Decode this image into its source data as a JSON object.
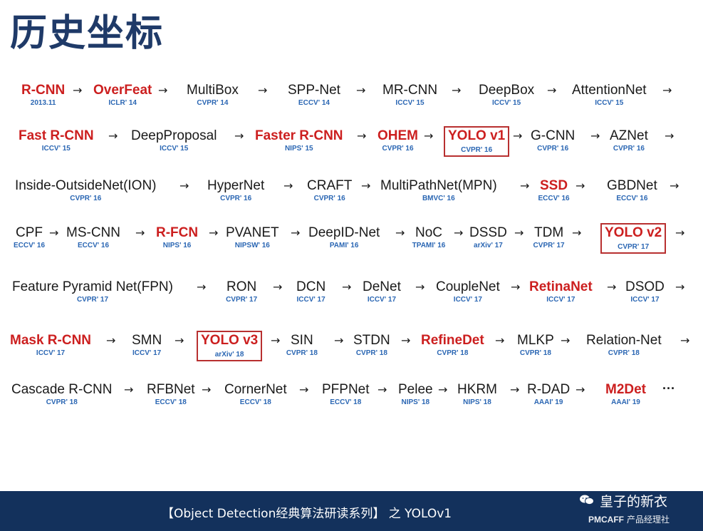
{
  "title": "历史坐标",
  "rows": [
    {
      "items": [
        {
          "name": "R-CNN",
          "venue": "2013.11",
          "highlight": true
        },
        {
          "name": "OverFeat",
          "venue": "ICLR' 14",
          "highlight": true
        },
        {
          "name": "MultiBox",
          "venue": "CVPR' 14"
        },
        {
          "name": "SPP-Net",
          "venue": "ECCV' 14"
        },
        {
          "name": "MR-CNN",
          "venue": "ICCV' 15"
        },
        {
          "name": "DeepBox",
          "venue": "ICCV' 15"
        },
        {
          "name": "AttentionNet",
          "venue": "ICCV' 15"
        }
      ]
    },
    {
      "items": [
        {
          "name": "Fast R-CNN",
          "venue": "ICCV' 15",
          "highlight": true
        },
        {
          "name": "DeepProposal",
          "venue": "ICCV' 15"
        },
        {
          "name": "Faster R-CNN",
          "venue": "NIPS' 15",
          "highlight": true
        },
        {
          "name": "OHEM",
          "venue": "CVPR' 16",
          "highlight": true
        },
        {
          "name": "YOLO v1",
          "venue": "CVPR' 16",
          "highlight": true,
          "boxed": true
        },
        {
          "name": "G-CNN",
          "venue": "CVPR' 16"
        },
        {
          "name": "AZNet",
          "venue": "CVPR' 16"
        }
      ]
    },
    {
      "items": [
        {
          "name": "Inside-OutsideNet(ION)",
          "venue": "CVPR' 16"
        },
        {
          "name": "HyperNet",
          "venue": "CVPR' 16"
        },
        {
          "name": "CRAFT",
          "venue": "CVPR' 16"
        },
        {
          "name": "MultiPathNet(MPN)",
          "venue": "BMVC' 16"
        },
        {
          "name": "SSD",
          "venue": "ECCV' 16",
          "highlight": true
        },
        {
          "name": "GBDNet",
          "venue": "ECCV' 16"
        }
      ]
    },
    {
      "items": [
        {
          "name": "CPF",
          "venue": "ECCV' 16"
        },
        {
          "name": "MS-CNN",
          "venue": "ECCV' 16"
        },
        {
          "name": "R-FCN",
          "venue": "NIPS' 16",
          "highlight": true
        },
        {
          "name": "PVANET",
          "venue": "NIPSW' 16"
        },
        {
          "name": "DeepID-Net",
          "venue": "PAMI' 16"
        },
        {
          "name": "NoC",
          "venue": "TPAMI' 16"
        },
        {
          "name": "DSSD",
          "venue": "arXiv' 17"
        },
        {
          "name": "TDM",
          "venue": "CVPR' 17"
        },
        {
          "name": "YOLO v2",
          "venue": "CVPR' 17",
          "highlight": true,
          "boxed": true
        }
      ]
    },
    {
      "items": [
        {
          "name": "Feature Pyramid Net(FPN)",
          "venue": "CVPR' 17"
        },
        {
          "name": "RON",
          "venue": "CVPR' 17"
        },
        {
          "name": "DCN",
          "venue": "ICCV' 17"
        },
        {
          "name": "DeNet",
          "venue": "ICCV' 17"
        },
        {
          "name": "CoupleNet",
          "venue": "ICCV' 17"
        },
        {
          "name": "RetinaNet",
          "venue": "ICCV' 17",
          "highlight": true
        },
        {
          "name": "DSOD",
          "venue": "ICCV' 17"
        }
      ]
    },
    {
      "items": [
        {
          "name": "Mask R-CNN",
          "venue": "ICCV' 17",
          "highlight": true
        },
        {
          "name": "SMN",
          "venue": "ICCV' 17"
        },
        {
          "name": "YOLO v3",
          "venue": "arXiv' 18",
          "highlight": true,
          "boxed": true
        },
        {
          "name": "SIN",
          "venue": "CVPR' 18"
        },
        {
          "name": "STDN",
          "venue": "CVPR' 18"
        },
        {
          "name": "RefineDet",
          "venue": "CVPR' 18",
          "highlight": true
        },
        {
          "name": "MLKP",
          "venue": "CVPR' 18"
        },
        {
          "name": "Relation-Net",
          "venue": "CVPR' 18"
        }
      ]
    },
    {
      "items": [
        {
          "name": "Cascade R-CNN",
          "venue": "CVPR' 18"
        },
        {
          "name": "RFBNet",
          "venue": "ECCV' 18"
        },
        {
          "name": "CornerNet",
          "venue": "ECCV' 18"
        },
        {
          "name": "PFPNet",
          "venue": "ECCV' 18"
        },
        {
          "name": "Pelee",
          "venue": "NIPS' 18"
        },
        {
          "name": "HKRM",
          "venue": "NIPS' 18"
        },
        {
          "name": "R-DAD",
          "venue": "AAAI' 19"
        },
        {
          "name": "M2Det",
          "venue": "AAAI' 19",
          "highlight": true
        }
      ]
    }
  ],
  "arrow_glyph": "→",
  "ellipsis": "···",
  "footer": {
    "text": "【Object Detection经典算法研读系列】  之  YOLOv1"
  },
  "watermark": {
    "name": "皇子的新衣",
    "brand": "PMCAFF",
    "brand_sub": "产品经理社"
  },
  "colors": {
    "highlight": "#cc1f1f",
    "venue": "#2a66b3",
    "footer_bg": "#13315c",
    "title": "#1f3a68"
  }
}
